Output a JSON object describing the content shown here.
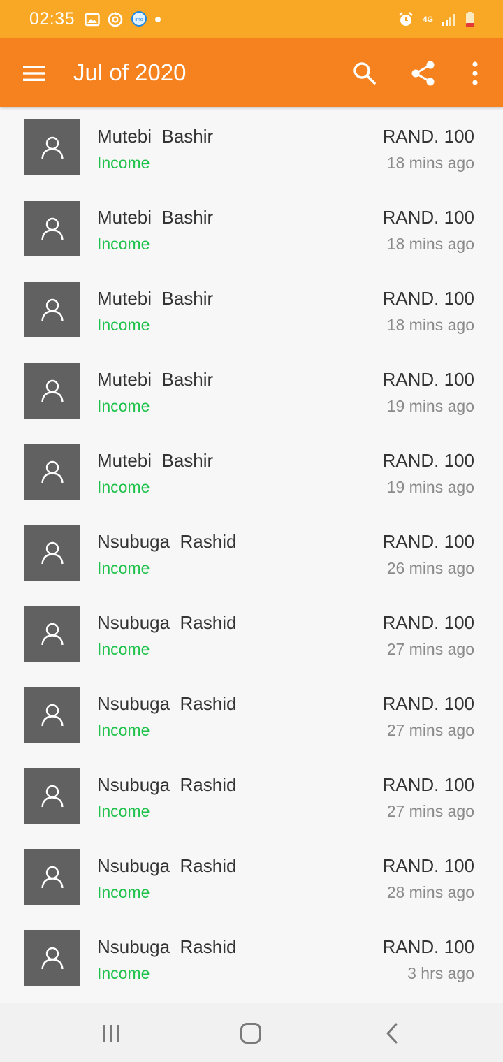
{
  "status_bar": {
    "time": "02:35",
    "left_icons": [
      "image-icon",
      "sync-icon",
      "imo-icon",
      "notification-dot-icon"
    ],
    "imo_label": "imo",
    "network_label": "4G",
    "right_icons": [
      "alarm-icon",
      "network-4g-icon",
      "signal-icon",
      "battery-low-icon"
    ]
  },
  "app_bar": {
    "title": "Jul of 2020",
    "color": "#f5821f",
    "actions": [
      "menu-icon",
      "search-icon",
      "share-icon",
      "more-vert-icon"
    ]
  },
  "colors": {
    "status_bar": "#f9a825",
    "income_green": "#1ec24a",
    "avatar_bg": "#616161"
  },
  "transactions": [
    {
      "name": "Mutebi  Bashir",
      "type": "Income",
      "amount": "RAND. 100",
      "time": "18 mins ago"
    },
    {
      "name": "Mutebi  Bashir",
      "type": "Income",
      "amount": "RAND. 100",
      "time": "18 mins ago"
    },
    {
      "name": "Mutebi  Bashir",
      "type": "Income",
      "amount": "RAND. 100",
      "time": "18 mins ago"
    },
    {
      "name": "Mutebi  Bashir",
      "type": "Income",
      "amount": "RAND. 100",
      "time": "19 mins ago"
    },
    {
      "name": "Mutebi  Bashir",
      "type": "Income",
      "amount": "RAND. 100",
      "time": "19 mins ago"
    },
    {
      "name": "Nsubuga  Rashid",
      "type": "Income",
      "amount": "RAND. 100",
      "time": "26 mins ago"
    },
    {
      "name": "Nsubuga  Rashid",
      "type": "Income",
      "amount": "RAND. 100",
      "time": "27 mins ago"
    },
    {
      "name": "Nsubuga  Rashid",
      "type": "Income",
      "amount": "RAND. 100",
      "time": "27 mins ago"
    },
    {
      "name": "Nsubuga  Rashid",
      "type": "Income",
      "amount": "RAND. 100",
      "time": "27 mins ago"
    },
    {
      "name": "Nsubuga  Rashid",
      "type": "Income",
      "amount": "RAND. 100",
      "time": "28 mins ago"
    },
    {
      "name": "Nsubuga  Rashid",
      "type": "Income",
      "amount": "RAND. 100",
      "time": "3 hrs ago"
    }
  ],
  "nav_bar": {
    "buttons": [
      "recent-apps-icon",
      "home-icon",
      "back-icon"
    ]
  }
}
